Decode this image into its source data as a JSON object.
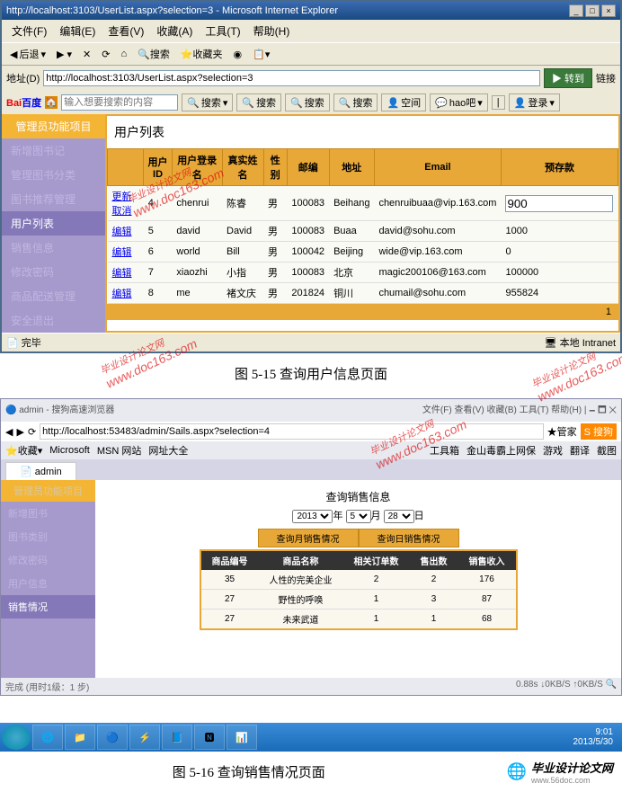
{
  "ie": {
    "title": "http://localhost:3103/UserList.aspx?selection=3 - Microsoft Internet Explorer",
    "menu": [
      "文件(F)",
      "编辑(E)",
      "查看(V)",
      "收藏(A)",
      "工具(T)",
      "帮助(H)"
    ],
    "back": "后退",
    "addr_label": "地址(D)",
    "url": "http://localhost:3103/UserList.aspx?selection=3",
    "go": "转到",
    "links": "链接",
    "baidu": "Bai百度",
    "search_ph": "输入想要搜索的内容",
    "search_btns": [
      "搜索",
      "搜索",
      "搜索",
      "搜索",
      "空间",
      "hao吧",
      "登录"
    ],
    "status_done": "完毕",
    "status_zone": "本地 Intranet"
  },
  "side": {
    "header": "管理员功能项目",
    "items": [
      "新增图书记",
      "管理图书分类",
      "图书推荐管理",
      "用户列表",
      "销售信息",
      "修改密码",
      "商品配送管理",
      "安全退出"
    ],
    "active": "用户列表"
  },
  "panel": {
    "title": "用户列表",
    "cols": [
      "",
      "用户ID",
      "用户登录名",
      "真实姓名",
      "性别",
      "邮编",
      "地址",
      "Email",
      "预存款"
    ],
    "rows": [
      {
        "actions": "更新 取消",
        "id": "4",
        "login": "chenrui",
        "name": "陈睿",
        "sex": "男",
        "zip": "100083",
        "addr": "Beihang",
        "email": "chenruibuaa@vip.163.com",
        "deposit": "900",
        "editable": true
      },
      {
        "actions": "编辑",
        "id": "5",
        "login": "david",
        "name": "David",
        "sex": "男",
        "zip": "100083",
        "addr": "Buaa",
        "email": "david@sohu.com",
        "deposit": "1000"
      },
      {
        "actions": "编辑",
        "id": "6",
        "login": "world",
        "name": "Bill",
        "sex": "男",
        "zip": "100042",
        "addr": "Beijing",
        "email": "wide@vip.163.com",
        "deposit": "0"
      },
      {
        "actions": "编辑",
        "id": "7",
        "login": "xiaozhi",
        "name": "小指",
        "sex": "男",
        "zip": "100083",
        "addr": "北京",
        "email": "magic200106@163.com",
        "deposit": "100000"
      },
      {
        "actions": "编辑",
        "id": "8",
        "login": "me",
        "name": "褚文庆",
        "sex": "男",
        "zip": "201824",
        "addr": "铜川",
        "email": "chumail@sohu.com",
        "deposit": "955824"
      }
    ],
    "page": "1"
  },
  "caption1": "图 5-15   查询用户信息页面",
  "win2": {
    "title": "admin - 搜狗高速浏览器",
    "url": "http://localhost:53483/admin/Sails.aspx?selection=4",
    "fav": "收藏",
    "fav_items": [
      "Microsoft",
      "MSN 网站",
      "网址大全"
    ],
    "right_items": [
      "工具箱",
      "金山毒霸上网保",
      "游戏",
      "翻译",
      "截图"
    ],
    "tab": "admin",
    "side_header": "管理员功能项目",
    "side_items": [
      "新增图书",
      "图书类别",
      "修改密码",
      "用户信息",
      "销售情况"
    ],
    "side_active": "销售情况",
    "sales_title": "查询销售信息",
    "year": "2013",
    "month": "5",
    "day": "28",
    "ylab": "年",
    "mlab": "月",
    "dlab": "日",
    "btn_month": "查询月销售情况",
    "btn_day": "查询日销售情况",
    "sales_cols": [
      "商品编号",
      "商品名称",
      "相关订单数",
      "售出数",
      "销售收入"
    ],
    "sales_rows": [
      {
        "id": "35",
        "name": "人性的完美企业",
        "orders": "2",
        "sold": "2",
        "rev": "176"
      },
      {
        "id": "27",
        "name": "野性的呼唤",
        "orders": "1",
        "sold": "3",
        "rev": "87"
      },
      {
        "id": "27",
        "name": "未来武道",
        "orders": "1",
        "sold": "1",
        "rev": "68"
      }
    ],
    "status": "完成 (用时1级：1 步)",
    "speed": "0.88s",
    "net1": "0KB/S",
    "net2": "0KB/S",
    "time": "9:01",
    "date": "2013/5/30"
  },
  "caption2": "图 5-16   查询销售情况页面",
  "watermark_url": "www.doc163.com",
  "watermark_cn": "毕业设计论文网",
  "footer": "毕业设计论文网",
  "footer_url": "www.56doc.com"
}
